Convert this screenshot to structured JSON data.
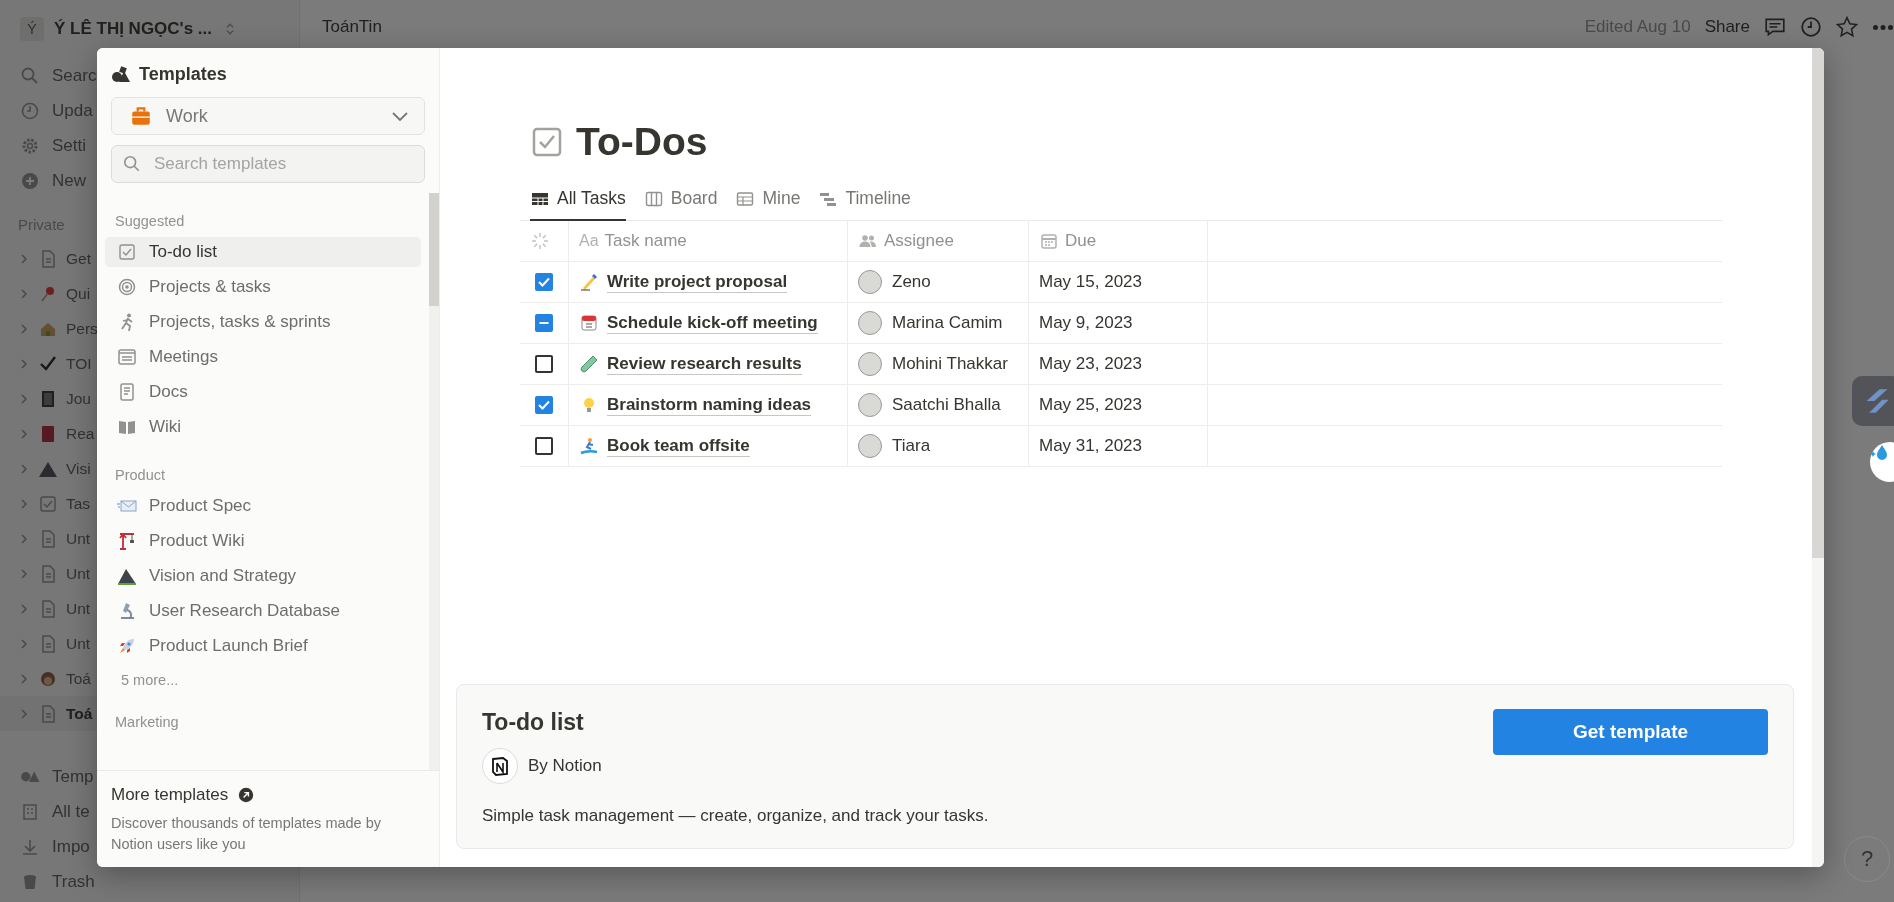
{
  "workspace": {
    "avatar": "Ý",
    "name": "Ý LÊ THỊ NGỌC's ..."
  },
  "sidebar": {
    "nav": [
      "Searc",
      "Upda",
      "Setti",
      "New"
    ],
    "section": "Private",
    "pages": [
      {
        "label": "Get",
        "selected": false
      },
      {
        "label": "Qui",
        "selected": false
      },
      {
        "label": "Pers",
        "selected": false
      },
      {
        "label": "TOI",
        "selected": false
      },
      {
        "label": "Jou",
        "selected": false
      },
      {
        "label": "Rea",
        "selected": false
      },
      {
        "label": "Visi",
        "selected": false
      },
      {
        "label": "Tas",
        "selected": false
      },
      {
        "label": "Unt",
        "selected": false
      },
      {
        "label": "Unt",
        "selected": false
      },
      {
        "label": "Unt",
        "selected": false
      },
      {
        "label": "Unt",
        "selected": false
      },
      {
        "label": "Toá",
        "selected": false
      },
      {
        "label": "Toá",
        "selected": true
      }
    ],
    "footer": [
      "Temp",
      "All te",
      "Impo",
      "Trash"
    ]
  },
  "topbar": {
    "breadcrumb": "ToánTin",
    "edited": "Edited Aug 10",
    "share": "Share"
  },
  "templates_panel": {
    "title": "Templates",
    "category": "Work",
    "search_placeholder": "Search templates",
    "groups": [
      {
        "heading": "Suggested",
        "items": [
          {
            "label": "To-do list",
            "selected": true
          },
          {
            "label": "Projects & tasks",
            "selected": false
          },
          {
            "label": "Projects, tasks & sprints",
            "selected": false
          },
          {
            "label": "Meetings",
            "selected": false
          },
          {
            "label": "Docs",
            "selected": false
          },
          {
            "label": "Wiki",
            "selected": false
          }
        ]
      },
      {
        "heading": "Product",
        "items": [
          {
            "label": "Product Spec",
            "selected": false
          },
          {
            "label": "Product Wiki",
            "selected": false
          },
          {
            "label": "Vision and Strategy",
            "selected": false
          },
          {
            "label": "User Research Database",
            "selected": false
          },
          {
            "label": "Product Launch Brief",
            "selected": false
          }
        ],
        "more": "5 more..."
      },
      {
        "heading": "Marketing"
      }
    ],
    "more_templates": {
      "title": "More templates",
      "description": "Discover thousands of templates made by Notion users like you"
    }
  },
  "preview": {
    "title": "To-Dos",
    "views": [
      {
        "label": "All Tasks",
        "selected": true
      },
      {
        "label": "Board",
        "selected": false
      },
      {
        "label": "Mine",
        "selected": false
      },
      {
        "label": "Timeline",
        "selected": false
      }
    ],
    "columns": [
      {
        "label": "Task name",
        "glyph": "Aa"
      },
      {
        "label": "Assignee"
      },
      {
        "label": "Due"
      }
    ],
    "rows": [
      {
        "checked": true,
        "indeterminate": false,
        "task": "Write project proposal",
        "assignee": "Zeno",
        "due": "May 15, 2023"
      },
      {
        "checked": false,
        "indeterminate": true,
        "task": "Schedule kick-off meeting",
        "assignee": "Marina Camim",
        "due": "May 9, 2023"
      },
      {
        "checked": false,
        "indeterminate": false,
        "task": "Review research results",
        "assignee": "Mohini Thakkar",
        "due": "May 23, 2023"
      },
      {
        "checked": true,
        "indeterminate": false,
        "task": "Brainstorm naming ideas",
        "assignee": "Saatchi Bhalla",
        "due": "May 25, 2023"
      },
      {
        "checked": false,
        "indeterminate": false,
        "task": "Book team offsite",
        "assignee": "Tiara",
        "due": "May 31, 2023"
      }
    ]
  },
  "details": {
    "title": "To-do list",
    "author": "By Notion",
    "description": "Simple task management — create, organize, and track your tasks.",
    "button": "Get template"
  },
  "help": "?"
}
